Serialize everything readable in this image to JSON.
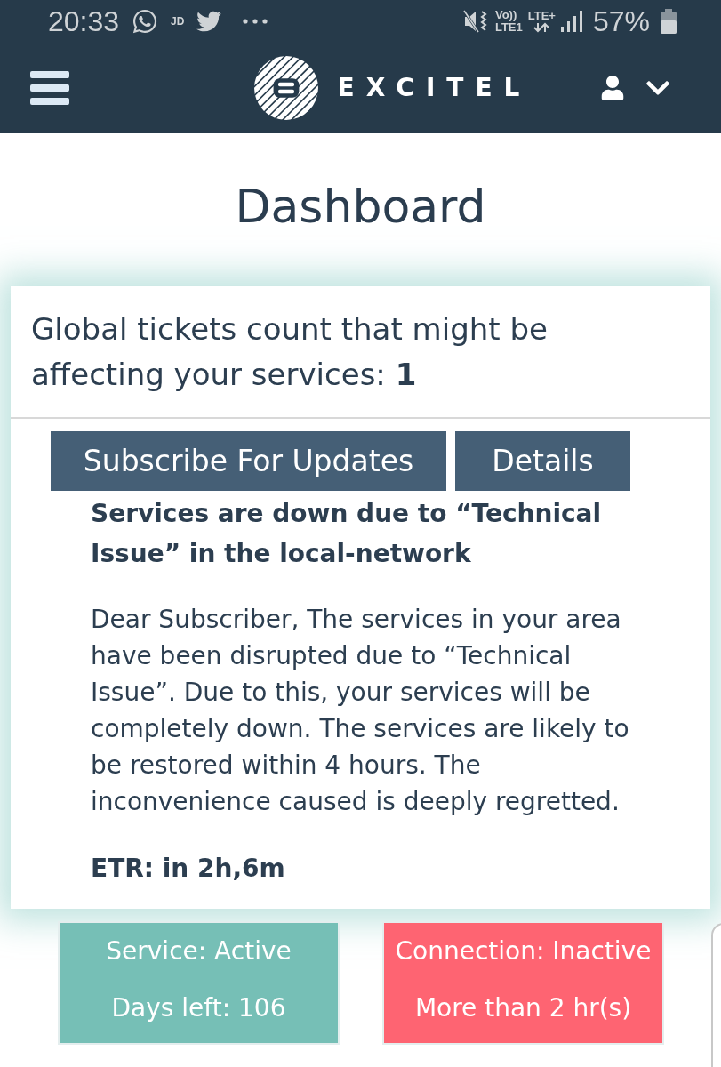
{
  "status_bar": {
    "time": "20:33",
    "notification_label": "JD",
    "network": {
      "volte": "Vo))",
      "sim": "LTE1",
      "type": "LTE+"
    },
    "battery": "57%"
  },
  "nav": {
    "brand": "EXCITEL"
  },
  "page_title": "Dashboard",
  "tickets_card": {
    "summary": "Global tickets count that might be affecting your services: **1**",
    "buttons": [
      "Subscribe For Updates",
      "Details"
    ],
    "incident_title": "Services are down due to “Technical Issue” in the local-network",
    "message": "Dear Subscriber, The services in your area have been disrupted due to “Technical Issue”. Due to this, your services will be completely down. The services are likely to be restored within 4 hours. The inconvenience caused is deeply regretted.",
    "etr": "ETR: in 2h,6m"
  },
  "status_tiles": [
    {
      "title": "Service: Active",
      "detail": "Days left: 106",
      "color": "#76bfb6"
    },
    {
      "title": "Connection: Inactive",
      "detail": "More than 2 hr(s)",
      "color": "#fe6472"
    }
  ]
}
